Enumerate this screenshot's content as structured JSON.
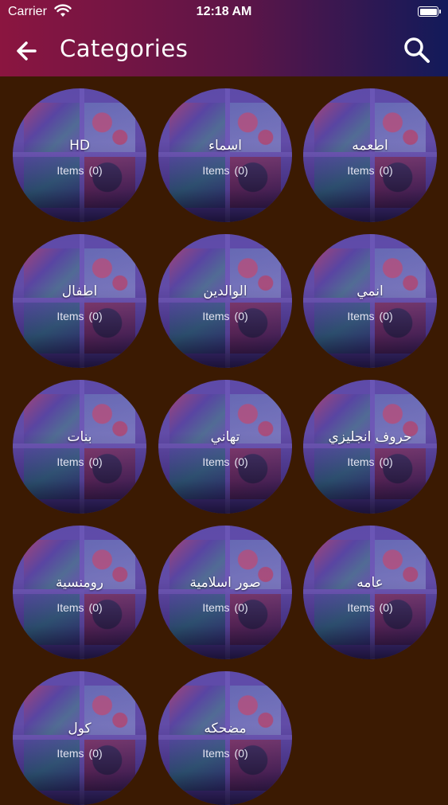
{
  "status_bar": {
    "carrier": "Carrier",
    "time": "12:18 AM"
  },
  "app_bar": {
    "title": "Categories",
    "back_icon": "arrow-left-icon",
    "search_icon": "search-icon"
  },
  "colors": {
    "background": "#3b1a02",
    "bar_start": "#8b1540",
    "bar_end": "#121a5a",
    "circle": "#4b3890"
  },
  "items_label": "Items",
  "categories": [
    {
      "name": "HD",
      "count": "(0)"
    },
    {
      "name": "اسماء",
      "count": "(0)"
    },
    {
      "name": "اطعمه",
      "count": "(0)"
    },
    {
      "name": "اطفال",
      "count": "(0)"
    },
    {
      "name": "الوالدين",
      "count": "(0)"
    },
    {
      "name": "انمي",
      "count": "(0)"
    },
    {
      "name": "بنات",
      "count": "(0)"
    },
    {
      "name": "تهاني",
      "count": "(0)"
    },
    {
      "name": "حروف انجليزي",
      "count": "(0)"
    },
    {
      "name": "رومنسية",
      "count": "(0)"
    },
    {
      "name": "صور اسلامية",
      "count": "(0)"
    },
    {
      "name": "عامه",
      "count": "(0)"
    },
    {
      "name": "كول",
      "count": "(0)"
    },
    {
      "name": "مضحكه",
      "count": "(0)"
    }
  ]
}
